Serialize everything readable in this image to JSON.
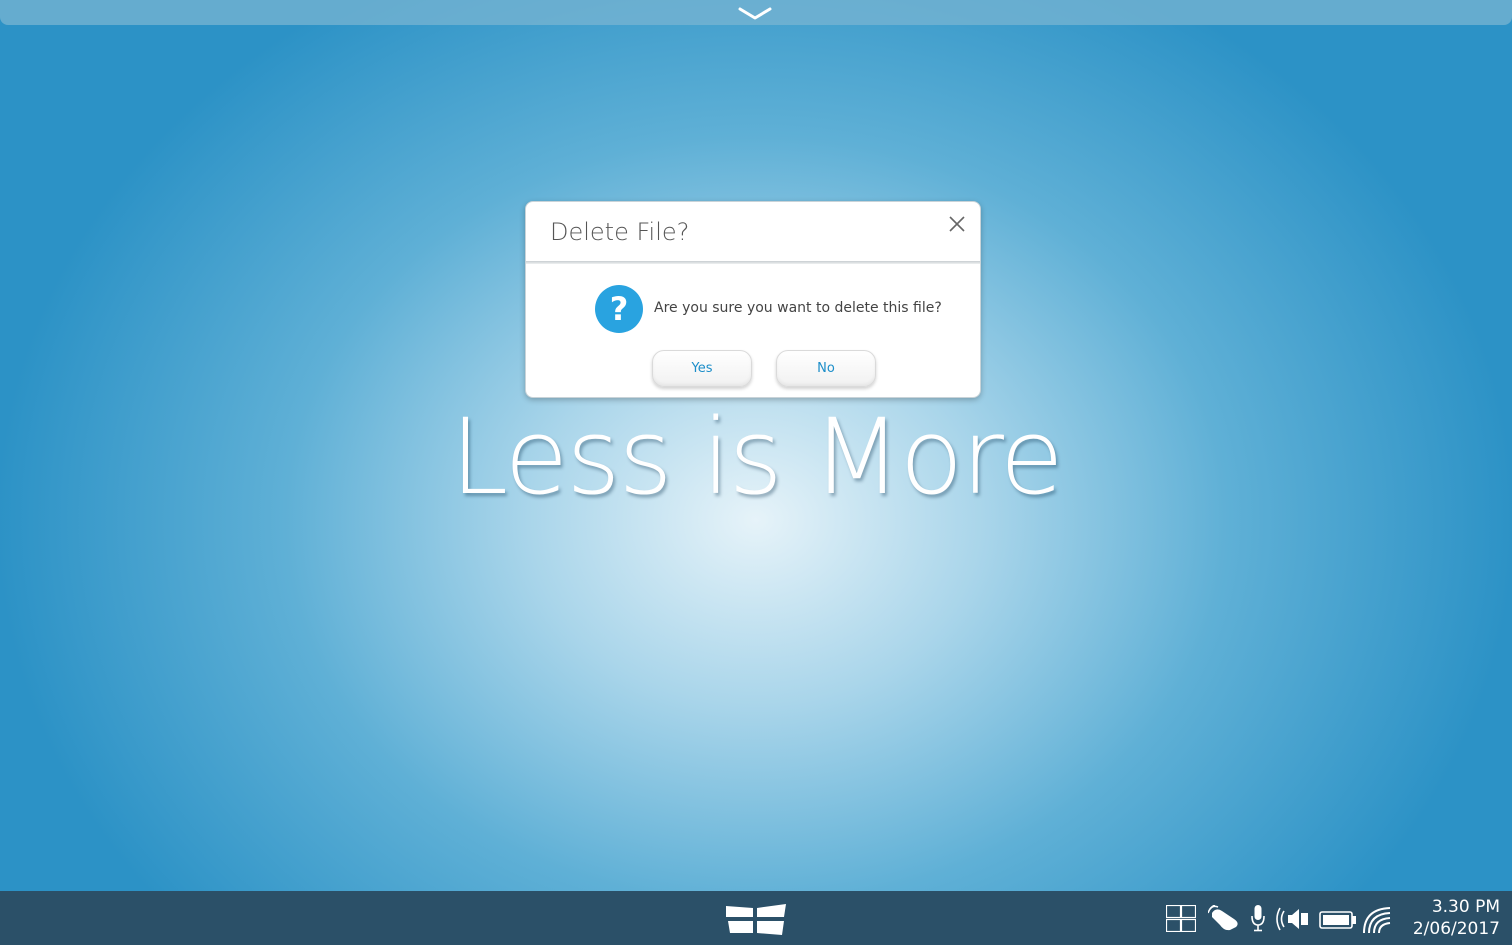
{
  "hero": {
    "text": "Less is More"
  },
  "dialog": {
    "title": "Delete File?",
    "message": "Are you sure you want to delete this file?",
    "yes_label": "Yes",
    "no_label": "No",
    "icon": "question-icon",
    "accent_color": "#29a3e0"
  },
  "top_bar": {
    "icon": "chevron-down-icon"
  },
  "taskbar": {
    "start_icon": "start-icon",
    "tray_icons": [
      "task-view-icon",
      "touch-icon",
      "microphone-icon",
      "speaker-icon",
      "battery-icon",
      "wifi-icon"
    ],
    "clock": {
      "time": "3.30 PM",
      "date": "2/06/2017"
    },
    "background_color": "#2b5068"
  }
}
